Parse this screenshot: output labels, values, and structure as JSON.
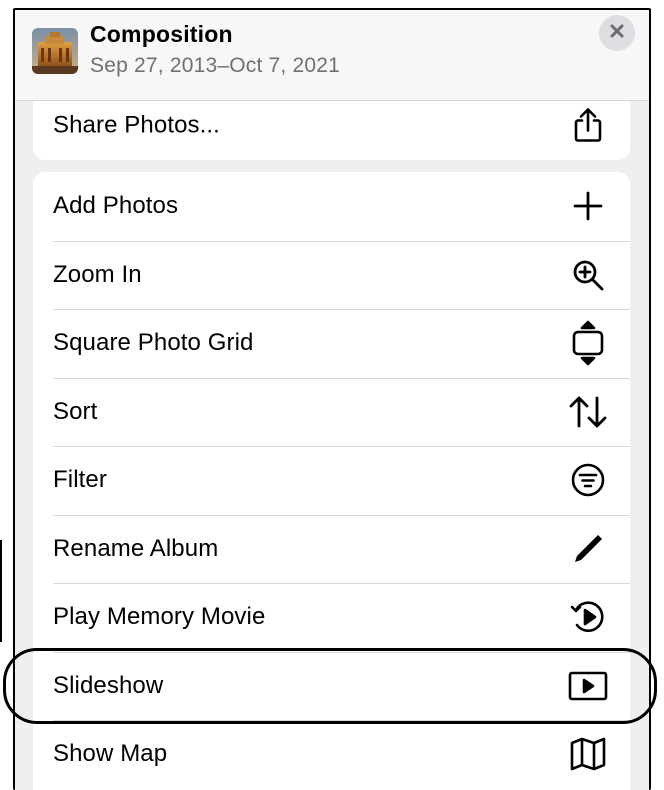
{
  "header": {
    "title": "Composition",
    "date_range": "Sep 27, 2013–Oct 7, 2021",
    "thumbnail_icon": "album-cover-image",
    "close_icon": "close-icon"
  },
  "top_group": [
    {
      "label": "Share Photos...",
      "icon": "share-icon"
    }
  ],
  "menu_items": [
    {
      "label": "Add Photos",
      "icon": "plus-icon"
    },
    {
      "label": "Zoom In",
      "icon": "zoom-in-icon"
    },
    {
      "label": "Square Photo Grid",
      "icon": "aspect-ratio-icon"
    },
    {
      "label": "Sort",
      "icon": "sort-icon"
    },
    {
      "label": "Filter",
      "icon": "filter-icon"
    },
    {
      "label": "Rename Album",
      "icon": "pencil-icon"
    },
    {
      "label": "Play Memory Movie",
      "icon": "memory-movie-icon"
    },
    {
      "label": "Slideshow",
      "icon": "slideshow-icon"
    },
    {
      "label": "Show Map",
      "icon": "map-icon"
    }
  ],
  "colors": {
    "sheet_background": "#efeff1",
    "row_background": "#ffffff",
    "secondary_text": "#707074",
    "separator": "#d8d8db",
    "close_button_bg": "#dedee2"
  }
}
